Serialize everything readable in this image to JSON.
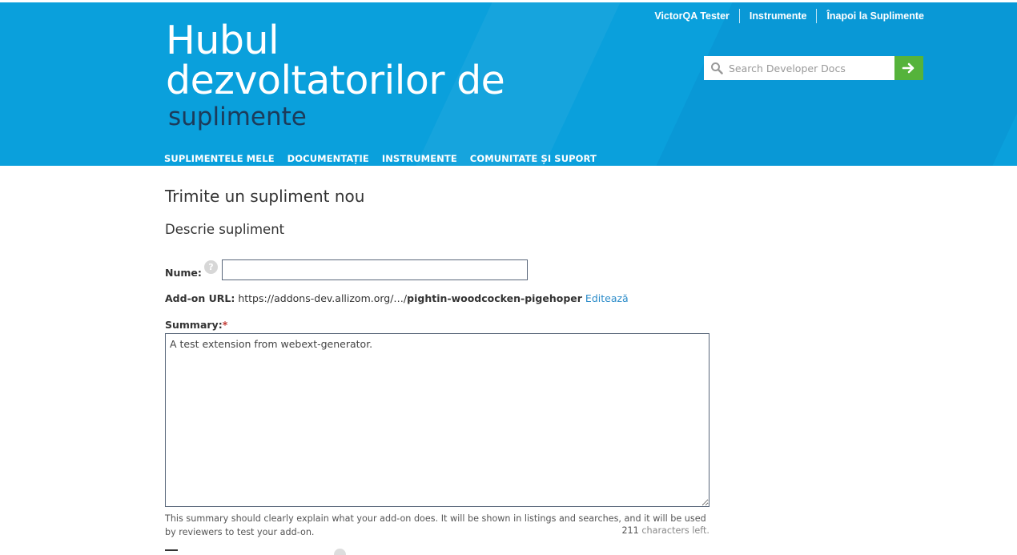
{
  "header": {
    "top_links": [
      "VictorQA Tester",
      "Instrumente",
      "Înapoi la Suplimente"
    ],
    "title_line1": "Hubul",
    "title_line2": "dezvoltatorilor de",
    "title_line3": "suplimente",
    "search_placeholder": "Search Developer Docs",
    "search_icon": "search-icon",
    "search_button_icon": "arrow-right-icon",
    "nav": [
      "SUPLIMENTELE MELE",
      "DOCUMENTAȚIE",
      "INSTRUMENTE",
      "COMUNITATE ȘI SUPORT"
    ],
    "colors": {
      "header_bg": "#0aa0dc",
      "accent_green": "#55b33b",
      "link": "#2a8bc9"
    }
  },
  "page": {
    "title": "Trimite un supliment nou",
    "section_title": "Descrie supliment",
    "name_label": "Nume:",
    "name_value": "",
    "help_glyph": "?",
    "url_label": "Add-on URL:",
    "url_prefix": "https://addons-dev.allizom.org/…/",
    "url_slug": "pightin-woodcocken-pigehoper",
    "url_edit": "Editează",
    "summary_label": "Summary:",
    "summary_required": "*",
    "summary_value": "A test extension from webext-generator.",
    "summary_hint": "This summary should clearly explain what your add-on does. It will be shown in listings and searches, and it will be used by reviewers to test your add-on.",
    "chars_left_count": "211",
    "chars_left_text": "characters left."
  }
}
